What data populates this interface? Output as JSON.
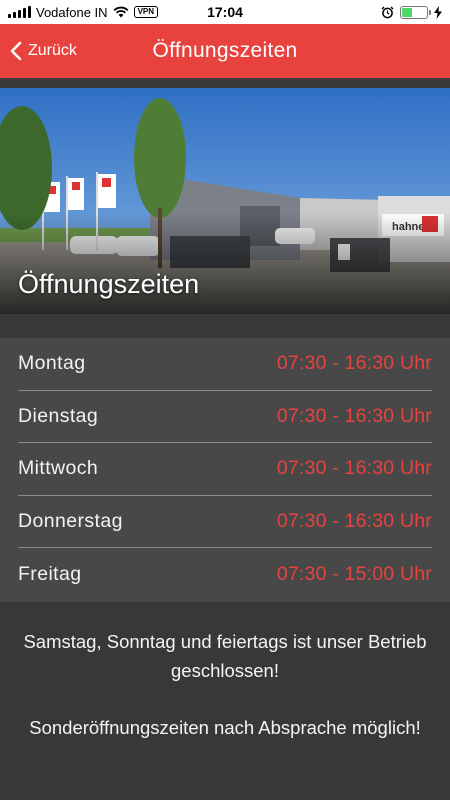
{
  "status_bar": {
    "carrier": "Vodafone IN",
    "vpn": "VPN",
    "time": "17:04"
  },
  "nav": {
    "back_label": "Zurück",
    "title": "Öffnungszeiten"
  },
  "hero": {
    "title": "Öffnungszeiten",
    "sign_text": "hahne"
  },
  "hours": [
    {
      "day": "Montag",
      "time": "07:30 - 16:30 Uhr"
    },
    {
      "day": "Dienstag",
      "time": "07:30 - 16:30 Uhr"
    },
    {
      "day": "Mittwoch",
      "time": "07:30 - 16:30 Uhr"
    },
    {
      "day": "Donnerstag",
      "time": "07:30 - 16:30 Uhr"
    },
    {
      "day": "Freitag",
      "time": "07:30 - 15:00 Uhr"
    }
  ],
  "notes": {
    "closed": "Samstag, Sonntag und feiertags ist unser Betrieb geschlossen!",
    "special": "Sonderöffnungszeiten nach Absprache möglich!"
  },
  "colors": {
    "accent": "#e8423e",
    "battery": "#4cd964"
  }
}
